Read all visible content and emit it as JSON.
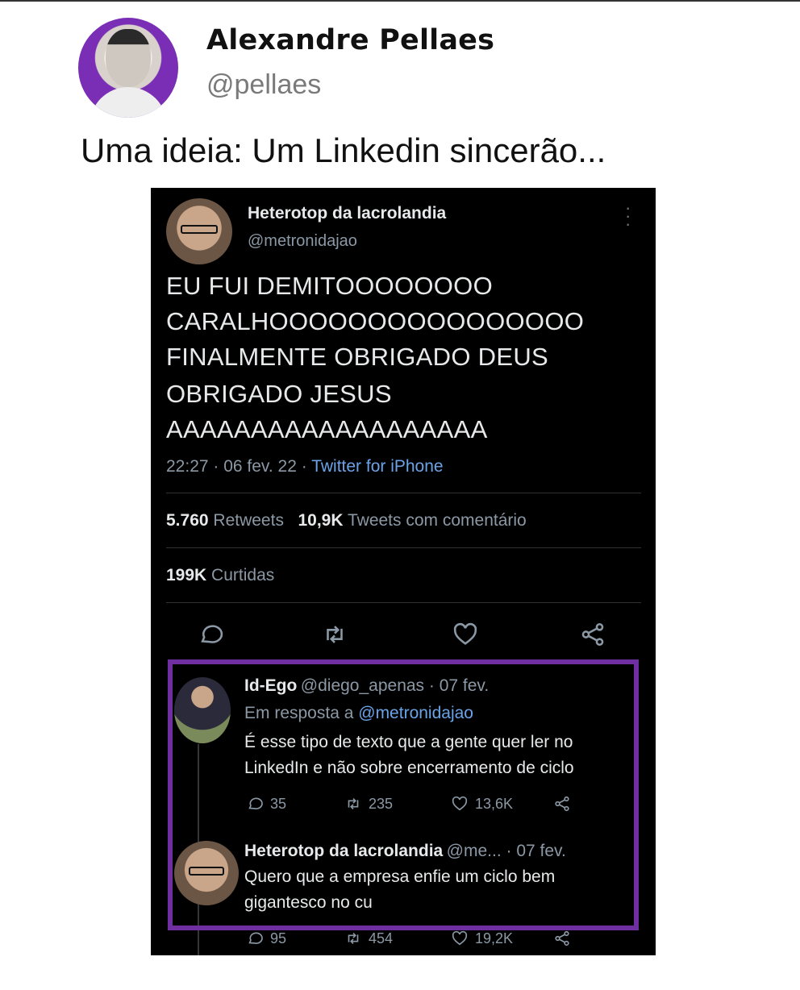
{
  "post": {
    "author_name": "Alexandre Pellaes",
    "author_handle": "@pellaes",
    "text": "Uma ideia: Um Linkedin sincerão..."
  },
  "tweet": {
    "name": "Heterotop da lacrolandia",
    "handle": "@metronidajao",
    "body": [
      "EU FUI DEMITOOOOOOOO",
      "CARALHOOOOOOOOOOOOOOOO",
      "FINALMENTE OBRIGADO DEUS",
      "OBRIGADO JESUS",
      "AAAAAAAAAAAAAAAAAAA"
    ],
    "time": "22:27 · 06 fev. 22 ·",
    "source": "Twitter for iPhone",
    "retweets_count": "5.760",
    "retweets_label": "Retweets",
    "quotes_count": "10,9K",
    "quotes_label": "Tweets com comentário",
    "likes_count": "199K",
    "likes_label": "Curtidas"
  },
  "replies": [
    {
      "name": "Id-Ego",
      "handle_date": "@diego_apenas · 07 fev.",
      "in_reply_prefix": "Em resposta a",
      "in_reply_handle": "@metronidajao",
      "text_lines": [
        "É esse tipo de texto que a gente quer ler no",
        "LinkedIn e não sobre encerramento de ciclo"
      ],
      "replies": "35",
      "retweets": "235",
      "likes": "13,6K"
    },
    {
      "name": "Heterotop da lacrolandia",
      "handle_date": "@me...  · 07 fev.",
      "text_lines": [
        "Quero que a empresa enfie um ciclo bem",
        "gigantesco no cu"
      ],
      "replies": "95",
      "retweets": "454",
      "likes": "19,2K"
    }
  ],
  "colors": {
    "accent_purple": "#6f2fa0",
    "link_blue": "#6aa3e8",
    "tweet_bg": "#000000"
  },
  "icons": [
    "reply-icon",
    "retweet-icon",
    "like-icon",
    "share-icon",
    "more-icon"
  ]
}
